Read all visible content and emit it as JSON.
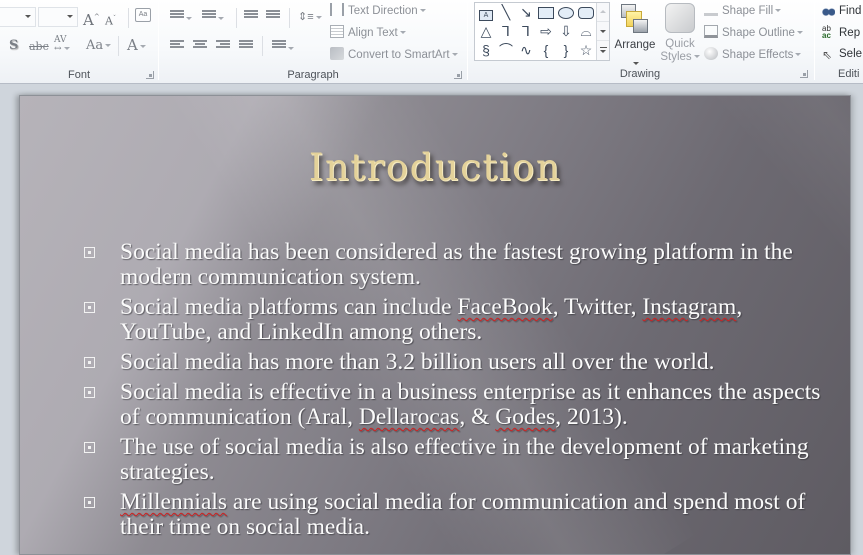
{
  "ribbon": {
    "font": {
      "label": "Font",
      "font_name_value": "",
      "font_size_value": "",
      "buttons": [
        "grow-font",
        "shrink-font",
        "clear-formatting",
        "text-shadow",
        "strikethrough",
        "character-spacing",
        "change-case",
        "font-color"
      ]
    },
    "paragraph": {
      "label": "Paragraph",
      "text_direction": "Text Direction",
      "align_text": "Align Text",
      "convert_smartart": "Convert to SmartArt"
    },
    "drawing": {
      "label": "Drawing",
      "arrange": "Arrange",
      "quick_styles_line1": "Quick",
      "quick_styles_line2": "Styles",
      "shape_fill": "Shape Fill",
      "shape_outline": "Shape Outline",
      "shape_effects": "Shape Effects",
      "gallery_shapes": [
        "text-box",
        "line",
        "arrow",
        "rectangle",
        "oval",
        "rounded-rectangle",
        "triangle",
        "elbow-connector",
        "elbow-arrow-connector",
        "right-arrow",
        "down-arrow",
        "freeform",
        "scribble",
        "arc",
        "curve",
        "left-brace",
        "right-brace",
        "star"
      ]
    },
    "editing": {
      "label": "Editi",
      "find": "Find",
      "replace": "Rep",
      "select": "Sele"
    }
  },
  "slide": {
    "title": "Introduction",
    "bullets": [
      {
        "parts": [
          {
            "t": "Social media has been considered as the fastest growing platform in the modern communication system."
          }
        ]
      },
      {
        "parts": [
          {
            "t": "Social media platforms can include "
          },
          {
            "t": "FaceBook",
            "spell": true
          },
          {
            "t": ", Twitter, "
          },
          {
            "t": "Instagram",
            "spell": true
          },
          {
            "t": ", YouTube, and LinkedIn among others."
          }
        ]
      },
      {
        "parts": [
          {
            "t": "Social media has more than 3.2 billion users all over the world."
          }
        ]
      },
      {
        "parts": [
          {
            "t": "Social media is effective in a business enterprise as it enhances the aspects of communication (Aral, "
          },
          {
            "t": "Dellarocas",
            "spell": true
          },
          {
            "t": ", & "
          },
          {
            "t": "Godes",
            "spell": true
          },
          {
            "t": ", 2013)."
          }
        ]
      },
      {
        "parts": [
          {
            "t": "The use of social media is also effective in the development of marketing strategies."
          }
        ]
      },
      {
        "parts": [
          {
            "t": "Millennials",
            "spell": true
          },
          {
            "t": " are using social media for communication and spend most of their time on social media."
          }
        ]
      }
    ]
  },
  "colors": {
    "title_gold": "#e4d29a",
    "bullet_text": "#fbfbfb",
    "spell_underline": "#d02020"
  }
}
